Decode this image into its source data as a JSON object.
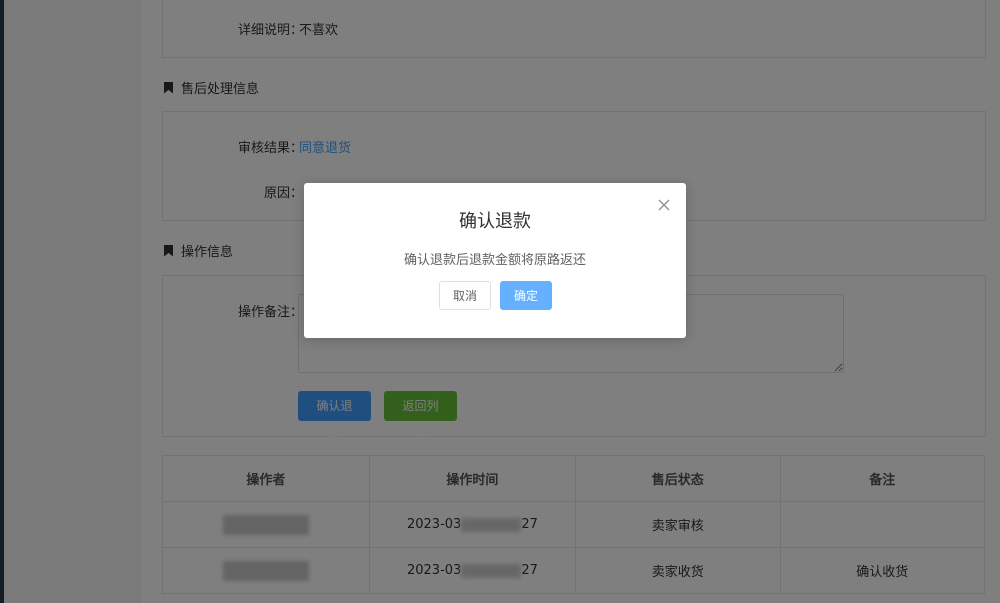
{
  "detail": {
    "desc_label": "详细说明：",
    "desc_value": "不喜欢"
  },
  "after_sale": {
    "title": "售后处理信息",
    "review_label": "审核结果：",
    "review_value": "同意退货",
    "reason_label": "原因："
  },
  "operation": {
    "title": "操作信息",
    "remark_label": "操作备注：",
    "remark_value": "",
    "confirm_refund_button": "确认退款",
    "back_list_button": "返回列表"
  },
  "log_table": {
    "headers": [
      "操作者",
      "操作时间",
      "售后状态",
      "备注"
    ],
    "rows": [
      {
        "operator": "",
        "time_prefix": "2023-03",
        "time_suffix": "27",
        "status": "卖家审核",
        "note": ""
      },
      {
        "operator": "",
        "time_prefix": "2023-03",
        "time_suffix": "27",
        "status": "卖家收货",
        "note": "确认收货"
      }
    ]
  },
  "dialog": {
    "title": "确认退款",
    "message": "确认退款后退款金额将原路返还",
    "cancel_label": "取消",
    "ok_label": "确定"
  },
  "colors": {
    "primary": "#409eff",
    "success": "#67c23a",
    "overlay": "rgba(0,0,0,0.5)"
  }
}
